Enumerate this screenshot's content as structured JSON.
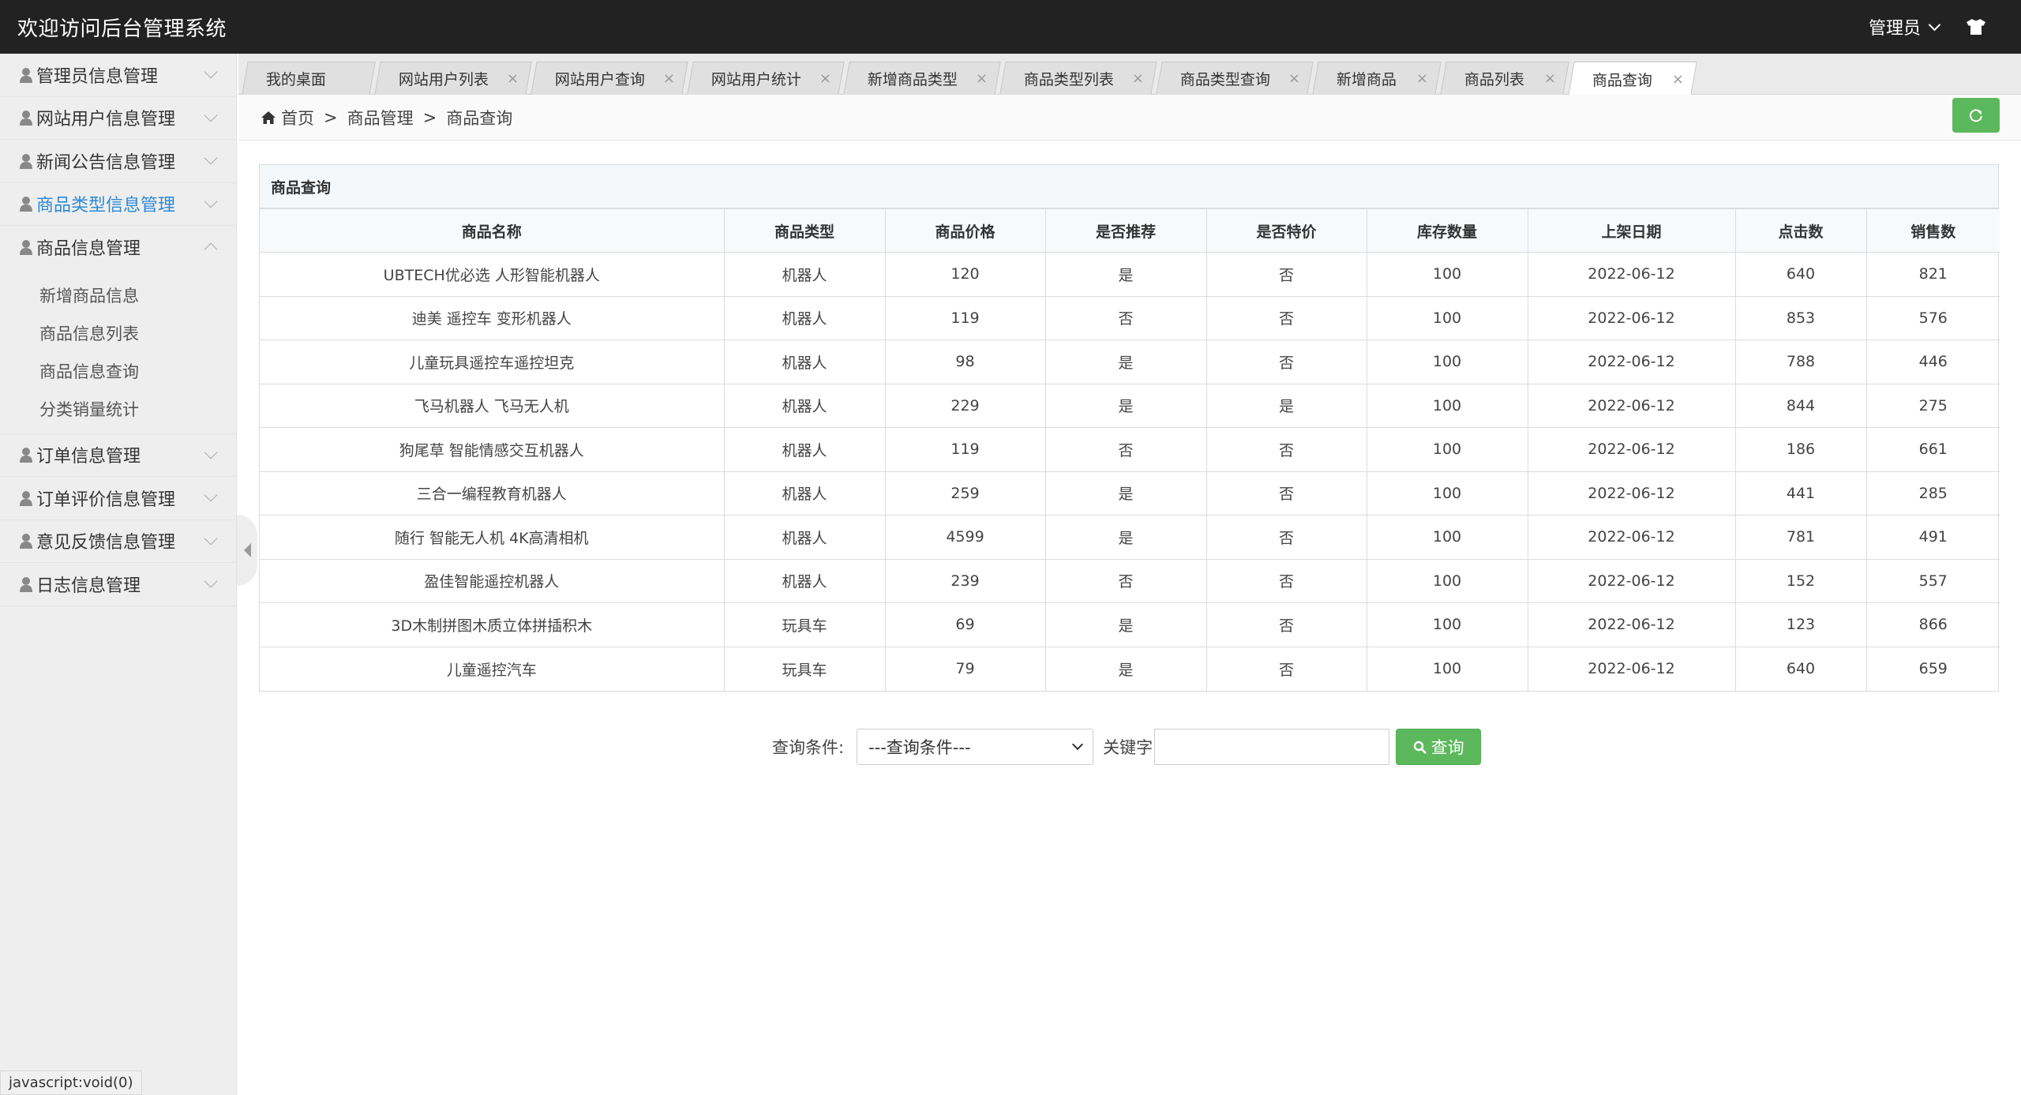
{
  "header": {
    "title": "欢迎访问后台管理系统",
    "admin_label": "管理员",
    "theme_icon": "tshirt-icon"
  },
  "sidebar": {
    "items": [
      {
        "label": "管理员信息管理"
      },
      {
        "label": "网站用户信息管理"
      },
      {
        "label": "新闻公告信息管理"
      },
      {
        "label": "商品类型信息管理",
        "active": true
      },
      {
        "label": "商品信息管理",
        "expanded": true
      },
      {
        "label": "订单信息管理"
      },
      {
        "label": "订单评价信息管理"
      },
      {
        "label": "意见反馈信息管理"
      },
      {
        "label": "日志信息管理"
      }
    ],
    "submenu": [
      "新增商品信息",
      "商品信息列表",
      "商品信息查询",
      "分类销量统计"
    ]
  },
  "status_hint": "javascript:void(0)",
  "tabs": [
    {
      "label": "我的桌面",
      "closable": false
    },
    {
      "label": "网站用户列表",
      "closable": true
    },
    {
      "label": "网站用户查询",
      "closable": true
    },
    {
      "label": "网站用户统计",
      "closable": true
    },
    {
      "label": "新增商品类型",
      "closable": true
    },
    {
      "label": "商品类型列表",
      "closable": true
    },
    {
      "label": "商品类型查询",
      "closable": true
    },
    {
      "label": "新增商品",
      "closable": true
    },
    {
      "label": "商品列表",
      "closable": true
    },
    {
      "label": "商品查询",
      "closable": true,
      "active": true
    }
  ],
  "close_glyph": "×",
  "breadcrumb": {
    "home": "首页",
    "sep": ">",
    "level1": "商品管理",
    "level2": "商品查询"
  },
  "panel": {
    "title": "商品查询",
    "columns": [
      "商品名称",
      "商品类型",
      "商品价格",
      "是否推荐",
      "是否特价",
      "库存数量",
      "上架日期",
      "点击数",
      "销售数"
    ],
    "rows": [
      [
        "UBTECH优必选 人形智能机器人",
        "机器人",
        "120",
        "是",
        "否",
        "100",
        "2022-06-12",
        "640",
        "821"
      ],
      [
        "迪美 遥控车 变形机器人",
        "机器人",
        "119",
        "否",
        "否",
        "100",
        "2022-06-12",
        "853",
        "576"
      ],
      [
        "儿童玩具遥控车遥控坦克",
        "机器人",
        "98",
        "是",
        "否",
        "100",
        "2022-06-12",
        "788",
        "446"
      ],
      [
        "飞马机器人 飞马无人机",
        "机器人",
        "229",
        "是",
        "是",
        "100",
        "2022-06-12",
        "844",
        "275"
      ],
      [
        "狗尾草 智能情感交互机器人",
        "机器人",
        "119",
        "否",
        "否",
        "100",
        "2022-06-12",
        "186",
        "661"
      ],
      [
        "三合一编程教育机器人",
        "机器人",
        "259",
        "是",
        "否",
        "100",
        "2022-06-12",
        "441",
        "285"
      ],
      [
        "随行 智能无人机 4K高清相机",
        "机器人",
        "4599",
        "是",
        "否",
        "100",
        "2022-06-12",
        "781",
        "491"
      ],
      [
        "盈佳智能遥控机器人",
        "机器人",
        "239",
        "否",
        "否",
        "100",
        "2022-06-12",
        "152",
        "557"
      ],
      [
        "3D木制拼图木质立体拼插积木",
        "玩具车",
        "69",
        "是",
        "否",
        "100",
        "2022-06-12",
        "123",
        "866"
      ],
      [
        "儿童遥控汽车",
        "玩具车",
        "79",
        "是",
        "否",
        "100",
        "2022-06-12",
        "640",
        "659"
      ]
    ]
  },
  "search": {
    "condition_label": "查询条件:",
    "condition_value": "---查询条件---",
    "keyword_label": "关键字",
    "keyword_value": "",
    "button_label": "查询"
  },
  "colors": {
    "header_bg": "#222222",
    "sidebar_bg": "#eeeeee",
    "active_link": "#2c89d6",
    "success_green": "#5cb85c"
  }
}
